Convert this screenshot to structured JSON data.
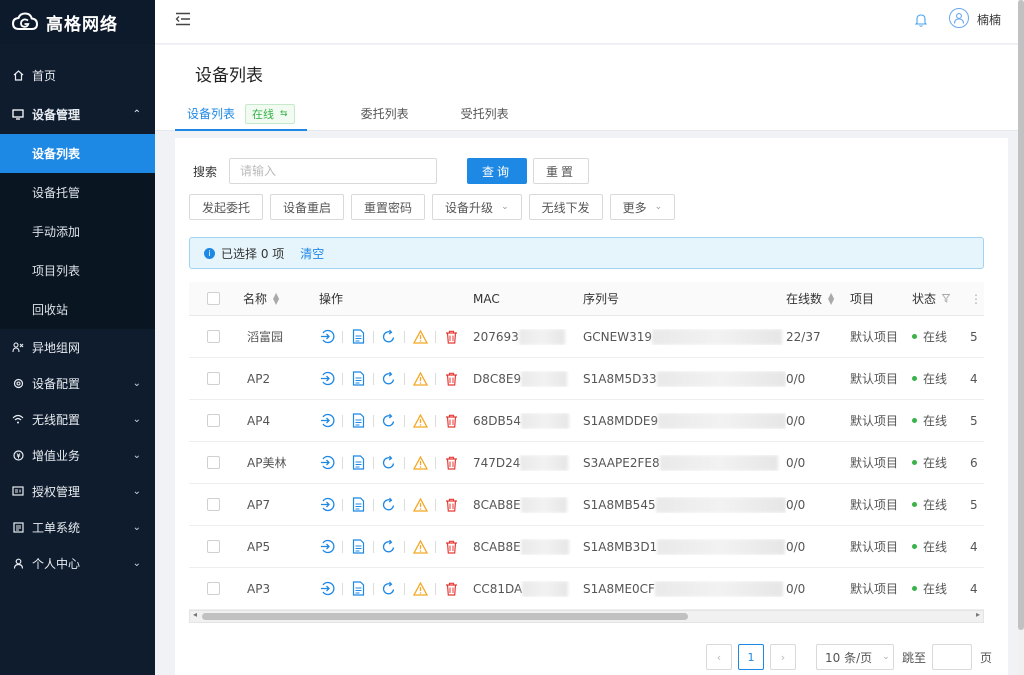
{
  "app": {
    "title": "高格网络"
  },
  "sidebar": {
    "items": [
      {
        "label": "首页",
        "icon": "home-icon"
      },
      {
        "label": "设备管理",
        "icon": "monitor-icon",
        "expanded": true,
        "children": [
          {
            "label": "设备列表",
            "active": true
          },
          {
            "label": "设备托管"
          },
          {
            "label": "手动添加"
          },
          {
            "label": "项目列表"
          },
          {
            "label": "回收站"
          }
        ]
      },
      {
        "label": "异地组网",
        "icon": "network-icon"
      },
      {
        "label": "设备配置",
        "icon": "gear-icon",
        "hasArrow": true
      },
      {
        "label": "无线配置",
        "icon": "wifi-icon",
        "hasArrow": true
      },
      {
        "label": "增值业务",
        "icon": "coin-icon",
        "hasArrow": true
      },
      {
        "label": "授权管理",
        "icon": "license-icon",
        "hasArrow": true
      },
      {
        "label": "工单系统",
        "icon": "ticket-icon",
        "hasArrow": true
      },
      {
        "label": "个人中心",
        "icon": "user-icon",
        "hasArrow": true
      }
    ]
  },
  "header": {
    "username": "楠楠"
  },
  "page": {
    "title": "设备列表",
    "tabs": [
      {
        "label": "设备列表",
        "active": true,
        "badge": "在线"
      },
      {
        "label": "委托列表"
      },
      {
        "label": "受托列表"
      }
    ]
  },
  "search": {
    "label": "搜索",
    "placeholder": "请输入",
    "value": "",
    "query_label": "查询",
    "reset_label": "重置"
  },
  "actions": {
    "delegate": "发起委托",
    "reboot": "设备重启",
    "reset_pwd": "重置密码",
    "upgrade": "设备升级",
    "wireless": "无线下发",
    "more": "更多"
  },
  "selection": {
    "text": "已选择 0 项",
    "clear": "清空"
  },
  "table": {
    "headers": {
      "name": "名称",
      "ops": "操作",
      "mac": "MAC",
      "sn": "序列号",
      "online": "在线数",
      "project": "项目",
      "status": "状态"
    },
    "rows": [
      {
        "name": "滔富园",
        "mac": "207693",
        "sn": "GCNEW319",
        "online": "22/37",
        "project": "默认项目",
        "status": "在线",
        "extra": "5"
      },
      {
        "name": "AP2",
        "mac": "D8C8E9",
        "sn": "S1A8M5D33",
        "online": "0/0",
        "project": "默认项目",
        "status": "在线",
        "extra": "4"
      },
      {
        "name": "AP4",
        "mac": "68DB54",
        "sn": "S1A8MDDE9",
        "online": "0/0",
        "project": "默认项目",
        "status": "在线",
        "extra": "5"
      },
      {
        "name": "AP美林",
        "mac": "747D24",
        "sn": "S3AAPE2FE8",
        "online": "0/0",
        "project": "默认项目",
        "status": "在线",
        "extra": "6"
      },
      {
        "name": "AP7",
        "mac": "8CAB8E",
        "sn": "S1A8MB545",
        "online": "0/0",
        "project": "默认项目",
        "status": "在线",
        "extra": "5"
      },
      {
        "name": "AP5",
        "mac": "8CAB8E",
        "sn": "S1A8MB3D1",
        "online": "0/0",
        "project": "默认项目",
        "status": "在线",
        "extra": "4"
      },
      {
        "name": "AP3",
        "mac": "CC81DA",
        "sn": "S1A8ME0CF",
        "online": "0/0",
        "project": "默认项目",
        "status": "在线",
        "extra": "4"
      }
    ]
  },
  "pagination": {
    "current": "1",
    "page_size": "10 条/页",
    "jump_label": "跳至",
    "page_suffix": "页"
  },
  "colors": {
    "primary": "#1e88e5",
    "sidebar_bg": "#0f1c2e",
    "online": "#38b249",
    "warn": "#f5a623",
    "danger": "#e53935"
  }
}
